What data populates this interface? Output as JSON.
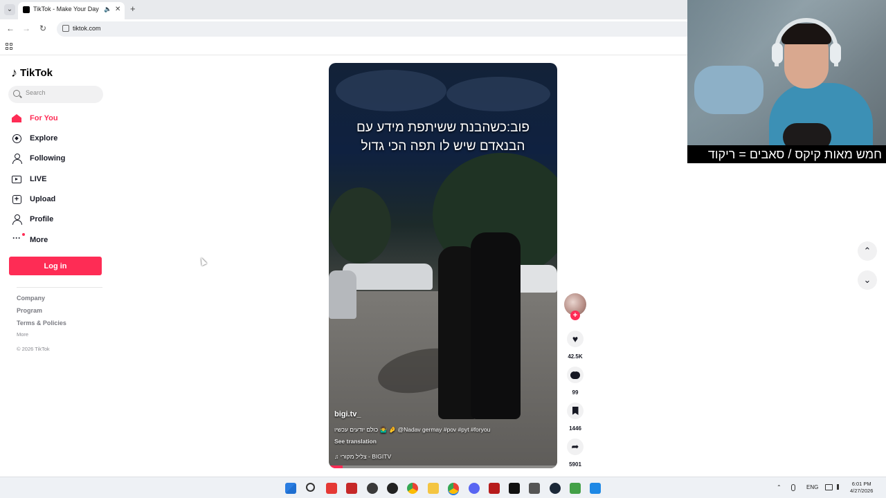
{
  "browser": {
    "tab_title": "TikTok - Make Your Day",
    "tab_close": "✕",
    "tab_mute": "🔈",
    "new_tab": "+",
    "url": "tiktok.com",
    "back": "←",
    "forward": "→",
    "reload": "↻"
  },
  "sidebar": {
    "logo_text": "TikTok",
    "logo_mark": "♪",
    "search_placeholder": "Search",
    "items": [
      {
        "label": "For You",
        "icon": "home-icon",
        "active": true
      },
      {
        "label": "Explore",
        "icon": "compass-icon"
      },
      {
        "label": "Following",
        "icon": "following-icon"
      },
      {
        "label": "LIVE",
        "icon": "live-icon"
      },
      {
        "label": "Upload",
        "icon": "upload-icon"
      },
      {
        "label": "Profile",
        "icon": "profile-icon"
      },
      {
        "label": "More",
        "icon": "more-icon"
      }
    ],
    "login_label": "Log in",
    "footer": {
      "company": "Company",
      "program": "Program",
      "terms": "Terms & Policies",
      "more": "More",
      "copyright": "© 2026 TikTok"
    }
  },
  "video": {
    "overlay_text_line1": "פוב:כשהבנת ששיתפת מידע עם",
    "overlay_text_line2": "הבנאדם שיש לו תפה הכי גדול",
    "username": "bigi.tv_",
    "caption": "כולם יודעים עכשיו 🤷‍♂️ 🤌 @Nadav germay #pov #pyt #foryou",
    "see_translation": "See translation",
    "music_icon": "♫",
    "music": "צליל מקורי - BIGITV",
    "progress": 0.06
  },
  "actions": {
    "follow_plus": "+",
    "like_icon": "♥",
    "likes": "42.5K",
    "comments": "99",
    "saves": "1446",
    "share_icon": "➦",
    "shares": "5901"
  },
  "feed_nav": {
    "up": "⌃",
    "down": "⌄"
  },
  "webcam_caption": "חמש מאות קיקס / סאבים = ריקוד",
  "taskbar": {
    "lang": "ENG",
    "time": "6:01 PM",
    "date": "4/27/2026",
    "tray_chevron": "⌃"
  },
  "colors": {
    "accent": "#fe2c55",
    "text": "#161823"
  }
}
